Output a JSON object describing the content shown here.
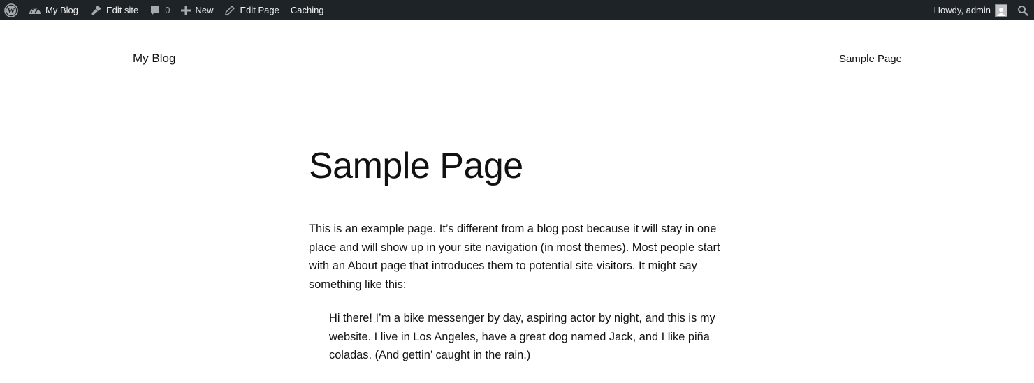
{
  "admin_bar": {
    "wp_logo_icon": "wordpress-logo",
    "items": [
      {
        "icon": "dashboard-icon",
        "label": "My Blog"
      },
      {
        "icon": "brush-icon",
        "label": "Edit site"
      },
      {
        "icon": "comment-icon",
        "label": "0"
      },
      {
        "icon": "plus-icon",
        "label": "New"
      },
      {
        "icon": "pencil-icon",
        "label": "Edit Page"
      },
      {
        "icon": "",
        "label": "Caching"
      }
    ],
    "greeting": "Howdy, admin",
    "search_icon": "search-icon"
  },
  "site": {
    "title": "My Blog",
    "nav": [
      {
        "label": "Sample Page"
      }
    ]
  },
  "page": {
    "title": "Sample Page",
    "paragraphs": [
      "This is an example page. It’s different from a blog post because it will stay in one place and will show up in your site navigation (in most themes). Most people start with an About page that introduces them to potential site visitors. It might say something like this:"
    ],
    "quote": "Hi there! I’m a bike messenger by day, aspiring actor by night, and this is my website. I live in Los Angeles, have a great dog named Jack, and I like piña coladas. (And gettin’ caught in the rain.)"
  },
  "colors": {
    "admin_bar_bg": "#1d2327",
    "admin_bar_text": "#f0f0f1",
    "page_bg": "#ffffff",
    "text": "#111111"
  }
}
